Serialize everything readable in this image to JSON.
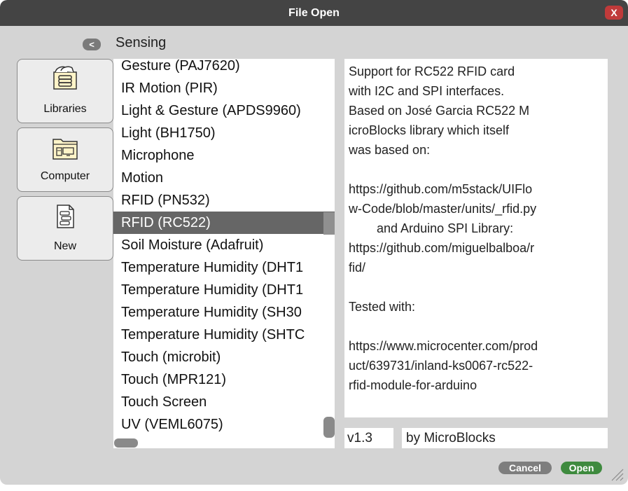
{
  "dialog": {
    "title": "File Open",
    "close_label": "X"
  },
  "nav": {
    "back_label": "<",
    "folder_title": "Sensing"
  },
  "sidebar": {
    "items": [
      {
        "label": "Libraries",
        "icon": "libraries-folder-icon"
      },
      {
        "label": "Computer",
        "icon": "computer-folder-icon"
      },
      {
        "label": "New",
        "icon": "new-file-icon"
      }
    ]
  },
  "file_list": {
    "items": [
      "Gesture (PAJ7620)",
      "IR Motion (PIR)",
      "Light & Gesture (APDS9960)",
      "Light (BH1750)",
      "Microphone",
      "Motion",
      "RFID (PN532)",
      "RFID (RC522)",
      "Soil Moisture (Adafruit)",
      "Temperature Humidity (DHT1",
      "Temperature Humidity (DHT1",
      "Temperature Humidity (SH30",
      "Temperature Humidity (SHTC",
      "Touch (microbit)",
      "Touch (MPR121)",
      "Touch Screen",
      "UV (VEML6075)"
    ],
    "selected": "RFID (RC522)"
  },
  "details": {
    "description": "Support for RC522 RFID card\nwith I2C and SPI interfaces.\nBased on José Garcia RC522 M\nicroBlocks library which itself\nwas based on:\n\nhttps://github.com/m5stack/UIFlo\nw-Code/blob/master/units/_rfid.py\n        and Arduino SPI Library:\nhttps://github.com/miguelbalboa/r\nfid/\n\nTested with:\n\nhttps://www.microcenter.com/prod\nuct/639731/inland-ks0067-rc522-\nrfid-module-for-arduino",
    "version": "v1.3",
    "author": "by MicroBlocks"
  },
  "footer": {
    "cancel_label": "Cancel",
    "open_label": "Open"
  },
  "colors": {
    "titlebar": "#444444",
    "dialog_bg": "#d4d4d4",
    "close": "#c03a3a",
    "selected_row": "#666666",
    "open_button": "#3e8a3e",
    "cancel_button": "#7e7e7e"
  }
}
